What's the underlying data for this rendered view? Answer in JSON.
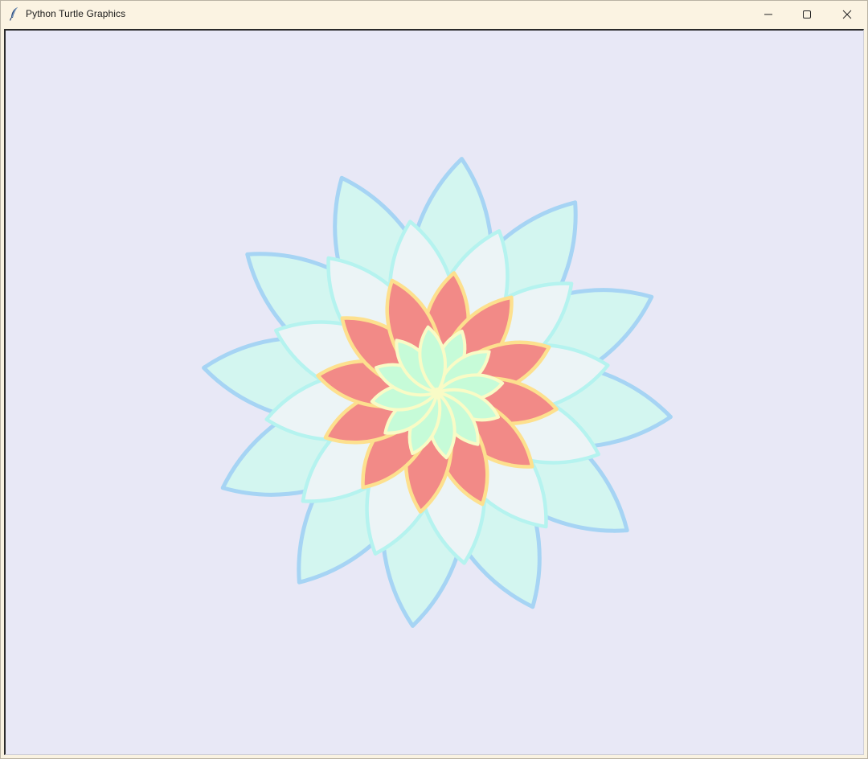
{
  "window": {
    "title": "Python Turtle Graphics",
    "icon": "feather-icon",
    "controls": [
      "minimize-icon",
      "maximize-icon",
      "close-icon"
    ]
  },
  "canvas": {
    "background": "#e8e8f6"
  },
  "drawing": {
    "layers": [
      {
        "name": "outer-petal",
        "count": 12,
        "fill": "#d3f6f0",
        "stroke": "#a6d4f4"
      },
      {
        "name": "middle-petal",
        "count": 12,
        "fill": "#ecf4f6",
        "stroke": "#b5f3ef"
      },
      {
        "name": "red-petal",
        "count": 12,
        "fill": "#f28a87",
        "stroke": "#fde08e"
      },
      {
        "name": "inner-petal",
        "count": 12,
        "fill": "#c6fbd8",
        "stroke": "#f9fbc6"
      }
    ]
  }
}
